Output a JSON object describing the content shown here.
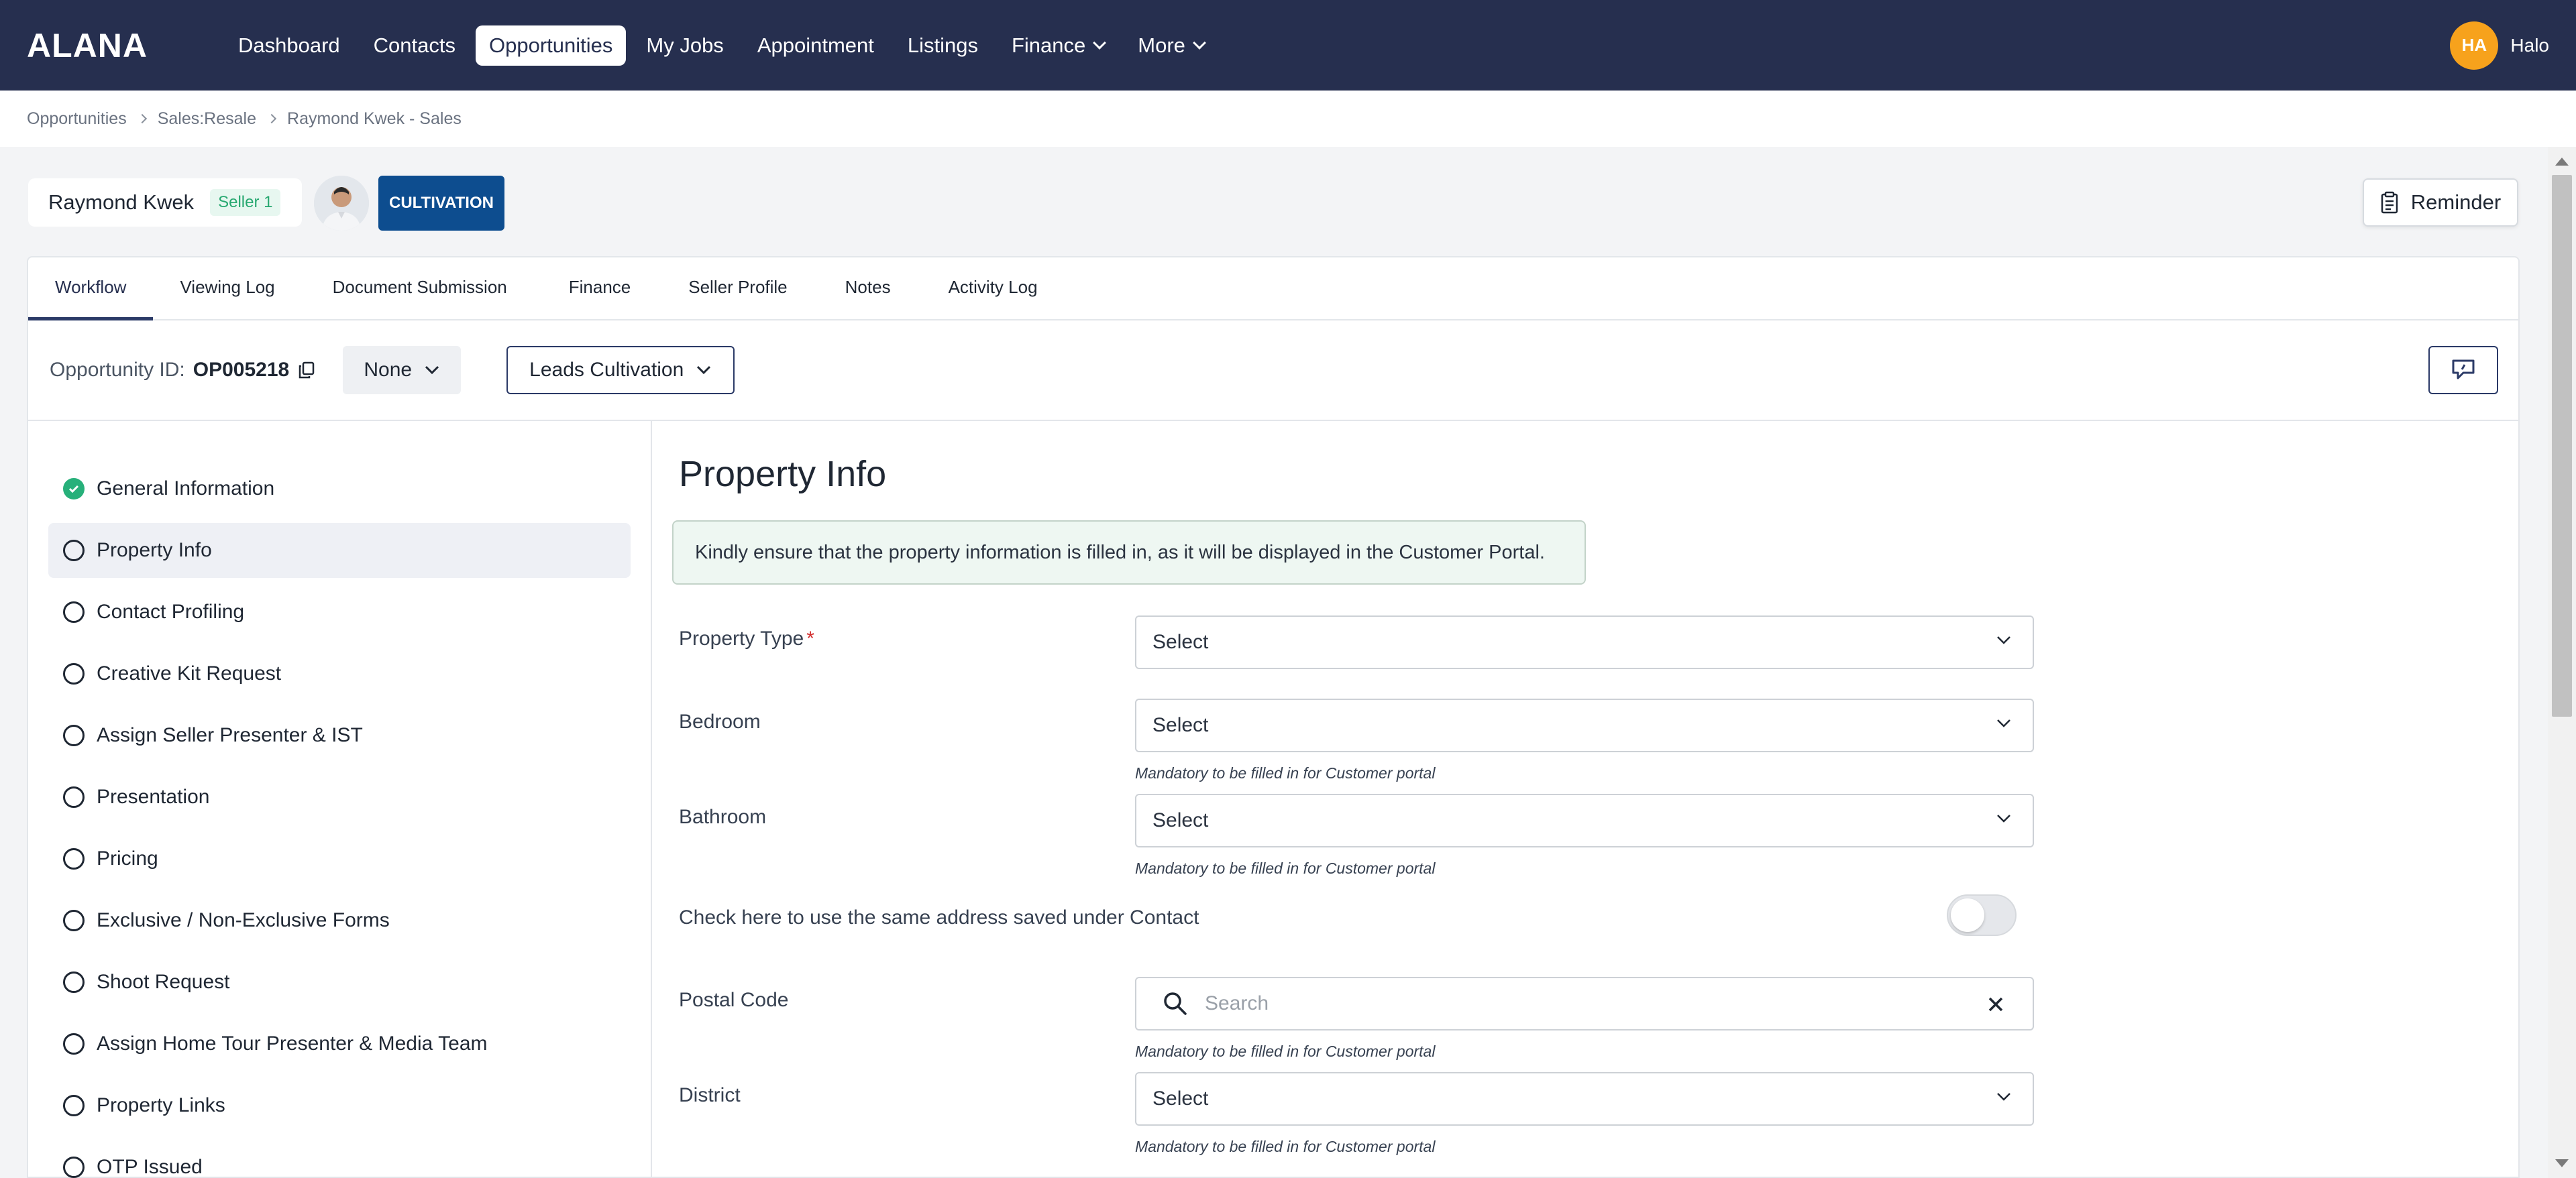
{
  "app": {
    "logo": "ALANA"
  },
  "nav": {
    "items": [
      {
        "label": "Dashboard"
      },
      {
        "label": "Contacts"
      },
      {
        "label": "Opportunities"
      },
      {
        "label": "My Jobs"
      },
      {
        "label": "Appointment"
      },
      {
        "label": "Listings"
      },
      {
        "label": "Finance"
      },
      {
        "label": "More"
      }
    ],
    "active": "Opportunities"
  },
  "user": {
    "initials": "HA",
    "name": "Halo"
  },
  "breadcrumb": [
    "Opportunities",
    "Sales:Resale",
    "Raymond Kwek - Sales"
  ],
  "header": {
    "contact_name": "Raymond Kwek",
    "seller_badge": "Seller 1",
    "stage_badge": "CULTIVATION",
    "reminder_label": "Reminder"
  },
  "tabs": [
    {
      "label": "Workflow"
    },
    {
      "label": "Viewing Log"
    },
    {
      "label": "Document Submission"
    },
    {
      "label": "Finance"
    },
    {
      "label": "Seller Profile"
    },
    {
      "label": "Notes"
    },
    {
      "label": "Activity Log"
    }
  ],
  "toolbar": {
    "opportunity_label": "Opportunity ID:",
    "opportunity_id": "OP005218",
    "none_label": "None",
    "pipeline_label": "Leads Cultivation"
  },
  "steps": [
    {
      "label": "General Information",
      "status": "done"
    },
    {
      "label": "Property Info",
      "status": "active"
    },
    {
      "label": "Contact Profiling",
      "status": "todo"
    },
    {
      "label": "Creative Kit Request",
      "status": "todo"
    },
    {
      "label": "Assign Seller Presenter & IST",
      "status": "todo"
    },
    {
      "label": "Presentation",
      "status": "todo"
    },
    {
      "label": "Pricing",
      "status": "todo"
    },
    {
      "label": "Exclusive / Non-Exclusive Forms",
      "status": "todo"
    },
    {
      "label": "Shoot Request",
      "status": "todo"
    },
    {
      "label": "Assign Home Tour Presenter & Media Team",
      "status": "todo"
    },
    {
      "label": "Property Links",
      "status": "todo"
    },
    {
      "label": "OTP Issued",
      "status": "todo"
    }
  ],
  "form": {
    "title": "Property Info",
    "notice": "Kindly ensure that the property information is filled in, as it will be displayed in the Customer Portal.",
    "property_type_label": "Property Type",
    "required_mark": "*",
    "select_placeholder": "Select",
    "bedroom_label": "Bedroom",
    "bathroom_label": "Bathroom",
    "hint": "Mandatory to be filled in for Customer portal",
    "same_address_label": "Check here to use the same address saved under Contact",
    "postal_code_label": "Postal Code",
    "search_placeholder": "Search",
    "district_label": "District"
  },
  "colors": {
    "nav_bg": "#262f4f",
    "accent": "#2b3a67",
    "stage_badge": "#0d4d8f",
    "success": "#27b07a",
    "avatar": "#f7a21c"
  }
}
